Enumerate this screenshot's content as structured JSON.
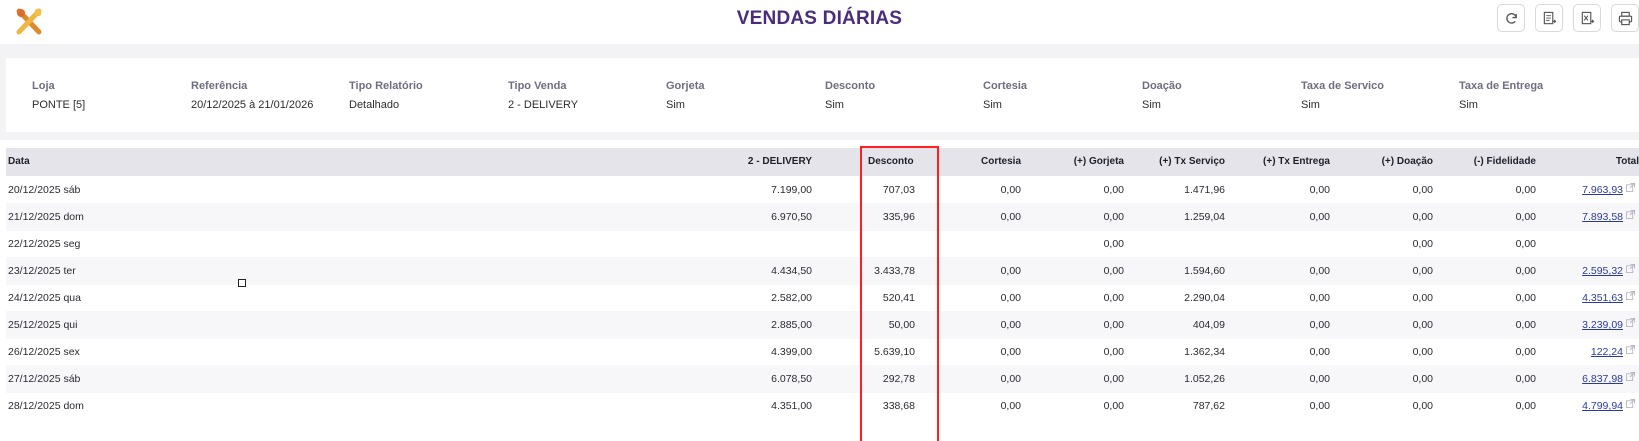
{
  "header": {
    "title": "VENDAS DIÁRIAS",
    "actions": [
      {
        "name": "refresh-button",
        "icon": "refresh-icon"
      },
      {
        "name": "export-pdf-button",
        "icon": "export-pdf-icon"
      },
      {
        "name": "export-excel-button",
        "icon": "export-excel-icon"
      },
      {
        "name": "print-button",
        "icon": "printer-icon"
      }
    ]
  },
  "filters": [
    {
      "label": "Loja",
      "value": "PONTE [5]"
    },
    {
      "label": "Referência",
      "value": "20/12/2025 à 21/01/2026"
    },
    {
      "label": "Tipo Relatório",
      "value": "Detalhado"
    },
    {
      "label": "Tipo Venda",
      "value": "2 - DELIVERY"
    },
    {
      "label": "Gorjeta",
      "value": "Sim"
    },
    {
      "label": "Desconto",
      "value": "Sim"
    },
    {
      "label": "Cortesia",
      "value": "Sim"
    },
    {
      "label": "Doação",
      "value": "Sim"
    },
    {
      "label": "Taxa de Servico",
      "value": "Sim"
    },
    {
      "label": "Taxa de Entrega",
      "value": "Sim"
    }
  ],
  "table": {
    "columns": [
      "Data",
      "2 - DELIVERY",
      "Desconto",
      "Cortesia",
      "(+) Gorjeta",
      "(+) Tx Serviço",
      "(+) Tx Entrega",
      "(+) Doação",
      "(-) Fidelidade",
      "Total"
    ],
    "rows": [
      [
        "20/12/2025 sáb",
        "7.199,00",
        "707,03",
        "0,00",
        "0,00",
        "1.471,96",
        "0,00",
        "0,00",
        "0,00",
        "7.963,93"
      ],
      [
        "21/12/2025 dom",
        "6.970,50",
        "335,96",
        "0,00",
        "0,00",
        "1.259,04",
        "0,00",
        "0,00",
        "0,00",
        "7.893,58"
      ],
      [
        "22/12/2025 seg",
        "",
        "",
        "",
        "0,00",
        "",
        "",
        "0,00",
        "0,00",
        ""
      ],
      [
        "23/12/2025 ter",
        "4.434,50",
        "3.433,78",
        "0,00",
        "0,00",
        "1.594,60",
        "0,00",
        "0,00",
        "0,00",
        "2.595,32"
      ],
      [
        "24/12/2025 qua",
        "2.582,00",
        "520,41",
        "0,00",
        "0,00",
        "2.290,04",
        "0,00",
        "0,00",
        "0,00",
        "4.351,63"
      ],
      [
        "25/12/2025 qui",
        "2.885,00",
        "50,00",
        "0,00",
        "0,00",
        "404,09",
        "0,00",
        "0,00",
        "0,00",
        "3.239,09"
      ],
      [
        "26/12/2025 sex",
        "4.399,00",
        "5.639,10",
        "0,00",
        "0,00",
        "1.362,34",
        "0,00",
        "0,00",
        "0,00",
        "122,24"
      ],
      [
        "27/12/2025 sáb",
        "6.078,50",
        "292,78",
        "0,00",
        "0,00",
        "1.052,26",
        "0,00",
        "0,00",
        "0,00",
        "6.837,98"
      ],
      [
        "28/12/2025 dom",
        "4.351,00",
        "338,68",
        "0,00",
        "0,00",
        "787,62",
        "0,00",
        "0,00",
        "0,00",
        "4.799,94"
      ]
    ]
  },
  "colors": {
    "title": "#4a2c7a",
    "highlight": "#ff1f1f",
    "link": "#2a3b9c",
    "header_bg": "#e4e4ea"
  }
}
